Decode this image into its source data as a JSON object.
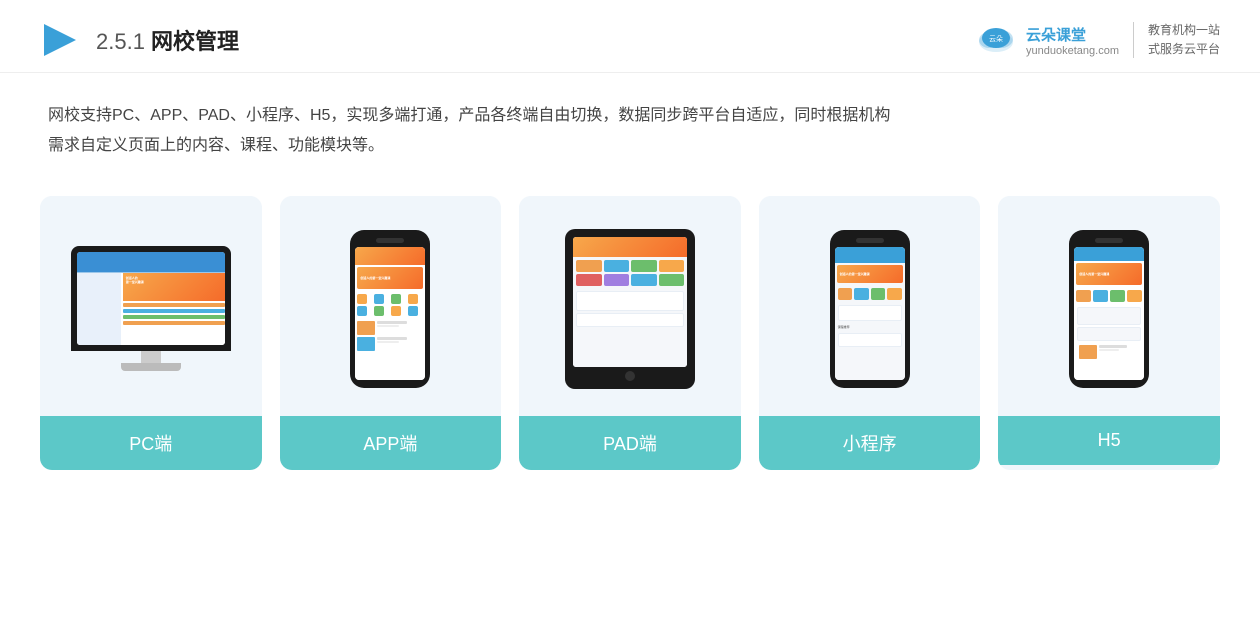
{
  "header": {
    "title_prefix": "2.5.1 ",
    "title_bold": "网校管理",
    "brand_name": "云朵课堂",
    "brand_url": "yunduoketang.com",
    "brand_slogan_line1": "教育机构一站",
    "brand_slogan_line2": "式服务云平台"
  },
  "description": {
    "line1": "网校支持PC、APP、PAD、小程序、H5，实现多端打通，产品各终端自由切换，数据同步跨平台自适应，同时根据机构",
    "line2": "需求自定义页面上的内容、课程、功能模块等。"
  },
  "cards": [
    {
      "id": "pc",
      "label": "PC端"
    },
    {
      "id": "app",
      "label": "APP端"
    },
    {
      "id": "pad",
      "label": "PAD端"
    },
    {
      "id": "miniprogram",
      "label": "小程序"
    },
    {
      "id": "h5",
      "label": "H5"
    }
  ]
}
